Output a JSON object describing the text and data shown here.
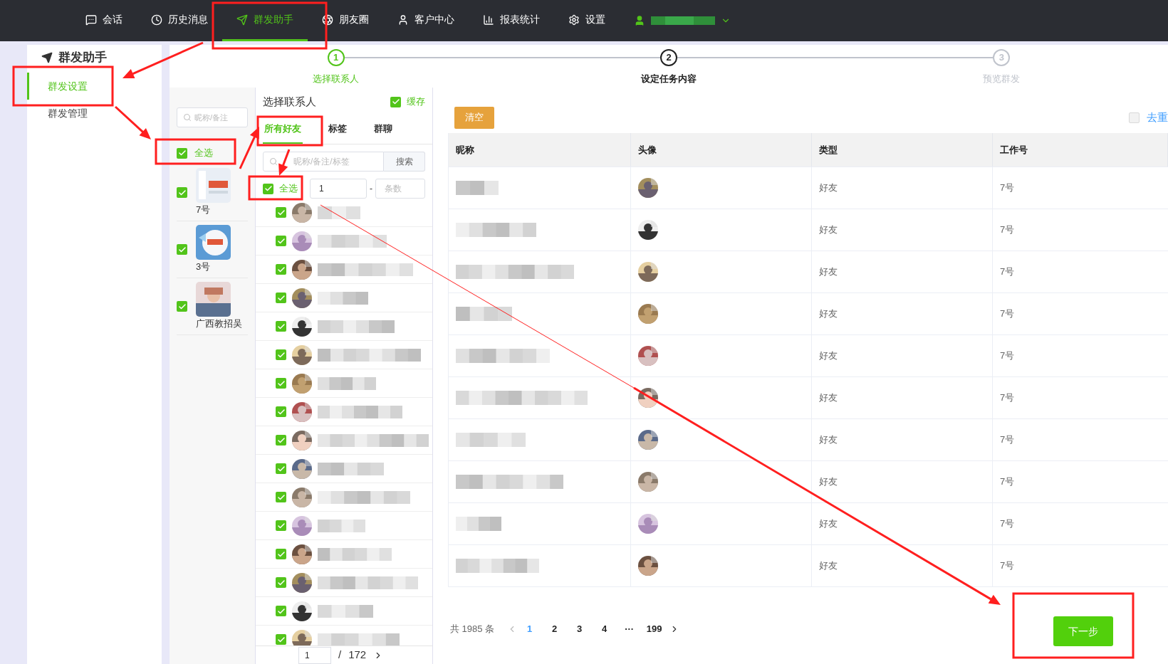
{
  "nav": {
    "items": [
      {
        "label": "会话",
        "selected": false
      },
      {
        "label": "历史消息",
        "selected": false
      },
      {
        "label": "群发助手",
        "selected": true
      },
      {
        "label": "朋友圈",
        "selected": false
      },
      {
        "label": "客户中心",
        "selected": false
      },
      {
        "label": "报表统计",
        "selected": false
      },
      {
        "label": "设置",
        "selected": false
      }
    ]
  },
  "sidebar": {
    "title": "群发助手",
    "items": [
      {
        "label": "群发设置",
        "selected": true
      },
      {
        "label": "群发管理",
        "selected": false
      }
    ]
  },
  "steps": [
    {
      "number": "1",
      "label": "选择联系人",
      "completed": true,
      "selected": false
    },
    {
      "number": "2",
      "label": "设定任务内容",
      "completed": false,
      "selected": true
    },
    {
      "number": "3",
      "label": "预览群发",
      "completed": false,
      "selected": false
    }
  ],
  "accounts": {
    "search_placeholder": "昵称/备注",
    "select_all": {
      "label": "全选",
      "checked": true
    },
    "items": [
      {
        "label": "7号",
        "checked": true
      },
      {
        "label": "3号",
        "checked": true
      },
      {
        "label": "广西教招吴",
        "checked": true
      }
    ]
  },
  "contacts": {
    "title": "选择联系人",
    "cache": {
      "label": "缓存",
      "checked": true
    },
    "tabs": [
      {
        "label": "所有好友",
        "selected": true
      },
      {
        "label": "标签",
        "selected": false
      },
      {
        "label": "群聊",
        "selected": false
      }
    ],
    "search_placeholder": "昵称/备注/标签",
    "search_button": "搜索",
    "select_all": {
      "label": "全选",
      "checked": true
    },
    "range_from": "1",
    "range_separator": "-",
    "range_to_placeholder": "条数",
    "items": [
      {
        "checked": true
      },
      {
        "checked": true
      },
      {
        "checked": true
      },
      {
        "checked": true
      },
      {
        "checked": true
      },
      {
        "checked": true
      },
      {
        "checked": true
      },
      {
        "checked": true
      },
      {
        "checked": true
      },
      {
        "checked": true
      },
      {
        "checked": true
      },
      {
        "checked": true
      },
      {
        "checked": true
      },
      {
        "checked": true
      },
      {
        "checked": true
      },
      {
        "checked": true
      }
    ],
    "page": "1",
    "page_separator": "/",
    "page_total": "172"
  },
  "clear_button": "清空",
  "dedupe": {
    "label": "去重",
    "checked": false
  },
  "table": {
    "columns": [
      "昵称",
      "头像",
      "类型",
      "工作号"
    ],
    "rows": [
      {
        "type": "好友",
        "work_no": "7号"
      },
      {
        "type": "好友",
        "work_no": "7号"
      },
      {
        "type": "好友",
        "work_no": "7号"
      },
      {
        "type": "好友",
        "work_no": "7号"
      },
      {
        "type": "好友",
        "work_no": "7号"
      },
      {
        "type": "好友",
        "work_no": "7号"
      },
      {
        "type": "好友",
        "work_no": "7号"
      },
      {
        "type": "好友",
        "work_no": "7号"
      },
      {
        "type": "好友",
        "work_no": "7号"
      },
      {
        "type": "好友",
        "work_no": "7号"
      }
    ]
  },
  "pagination": {
    "total": "共 1985 条",
    "pages": [
      {
        "label": "1",
        "selected": true
      },
      {
        "label": "2",
        "selected": false
      },
      {
        "label": "3",
        "selected": false
      },
      {
        "label": "4",
        "selected": false
      },
      {
        "label": "···",
        "selected": false
      },
      {
        "label": "199",
        "selected": false
      }
    ]
  },
  "next_button": "下一步"
}
